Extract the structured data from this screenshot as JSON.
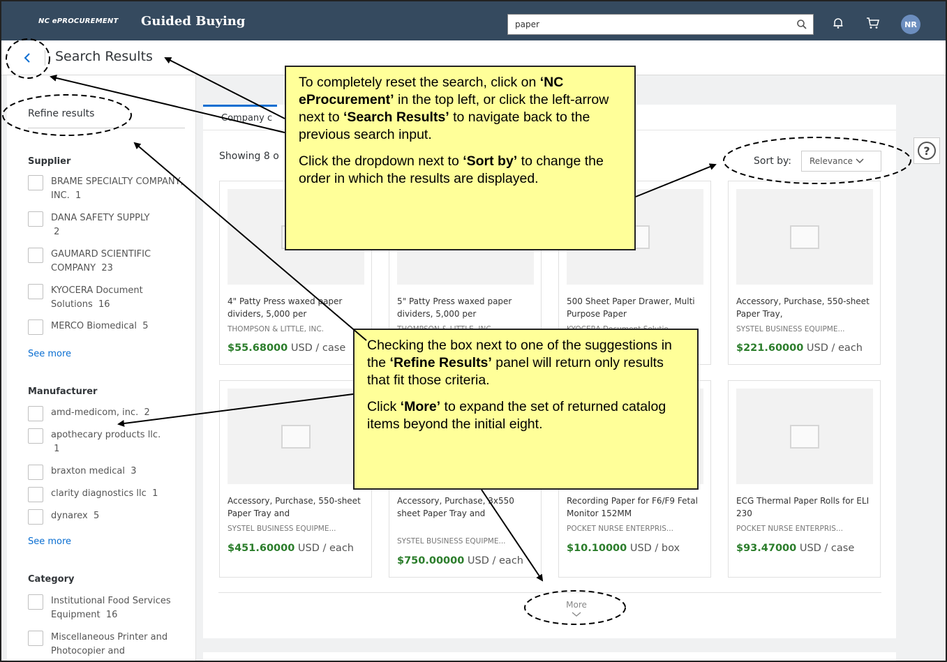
{
  "header": {
    "brand": "NC ePROCUREMENT",
    "title": "Guided Buying",
    "search_value": "paper",
    "avatar": "NR"
  },
  "subheader": {
    "title": "Search Results"
  },
  "sidebar": {
    "refine_title": "Refine results",
    "supplier": {
      "title": "Supplier",
      "items": [
        {
          "label": "BRAME SPECIALTY COMPANY, INC.",
          "count": "1"
        },
        {
          "label": "DANA SAFETY SUPPLY",
          "count": "2"
        },
        {
          "label": "GAUMARD SCIENTIFIC COMPANY",
          "count": "23"
        },
        {
          "label": "KYOCERA Document Solutions",
          "count": "16"
        },
        {
          "label": "MERCO Biomedical",
          "count": "5"
        }
      ],
      "see_more": "See more"
    },
    "manufacturer": {
      "title": "Manufacturer",
      "items": [
        {
          "label": "amd-medicom, inc.",
          "count": "2"
        },
        {
          "label": "apothecary products llc.",
          "count": "1"
        },
        {
          "label": "braxton medical",
          "count": "3"
        },
        {
          "label": "clarity diagnostics llc",
          "count": "1"
        },
        {
          "label": "dynarex",
          "count": "5"
        }
      ],
      "see_more": "See more"
    },
    "category": {
      "title": "Category",
      "items": [
        {
          "label": "Institutional Food Services Equipment",
          "count": "16"
        },
        {
          "label": "Miscellaneous Printer and Photocopier and",
          "count": ""
        }
      ]
    }
  },
  "main": {
    "tab": "Company c",
    "showing": "Showing 8 o",
    "sort_label": "Sort by:",
    "sort_value": "Relevance",
    "more_label": "More",
    "cards": [
      {
        "name": "4\" Patty Press waxed paper dividers, 5,000 per",
        "supplier": "THOMPSON & LITTLE, INC.",
        "price": "$55.68000",
        "unit": "USD / case"
      },
      {
        "name": "5\" Patty Press waxed paper dividers, 5,000 per",
        "supplier": "THOMPSON & LITTLE, INC.",
        "price": "",
        "unit": ""
      },
      {
        "name": "500 Sheet Paper Drawer, Multi Purpose Paper",
        "supplier": "KYOCERA Document Solutio",
        "price": "",
        "unit": ""
      },
      {
        "name": "Accessory, Purchase, 550-sheet Paper Tray,",
        "supplier": "SYSTEL BUSINESS EQUIPME...",
        "price": "$221.60000",
        "unit": "USD / each"
      },
      {
        "name": "Accessory, Purchase, 550-sheet Paper Tray and",
        "supplier": "SYSTEL BUSINESS EQUIPME...",
        "price": "$451.60000",
        "unit": "USD / each"
      },
      {
        "name": "Accessory, Purchase, 3x550 sheet Paper Tray and",
        "supplier": "SYSTEL BUSINESS EQUIPME...",
        "price": "$750.00000",
        "unit": "USD / each"
      },
      {
        "name": "Recording Paper for F6/F9 Fetal Monitor 152MM",
        "supplier": "POCKET NURSE ENTERPRIS...",
        "price": "$10.10000",
        "unit": "USD / box"
      },
      {
        "name": "ECG Thermal Paper Rolls for ELI 230",
        "supplier": "POCKET NURSE ENTERPRIS...",
        "price": "$93.47000",
        "unit": "USD / case"
      }
    ]
  },
  "callouts": {
    "top": {
      "p1_a": "To completely reset the search, click on ",
      "p1_b": "‘NC eProcurement’",
      "p1_c": " in the top left, or click the left-arrow next to ",
      "p1_d": "‘Search Results’",
      "p1_e": " to navigate back to the previous search input.",
      "p2_a": "Click the dropdown next to ",
      "p2_b": "‘Sort by’",
      "p2_c": " to change the order in which the results are displayed."
    },
    "bottom": {
      "p1_a": "Checking the box next to one of the suggestions in the ",
      "p1_b": "‘Refine Results’",
      "p1_c": " panel will return only results that fit those criteria.",
      "p2_a": "Click ",
      "p2_b": "‘More’",
      "p2_c": " to expand the set of returned catalog items beyond the initial eight."
    }
  },
  "colors": {
    "shellbar": "#354a5f",
    "link": "#0a6ed1",
    "price": "#2b7d2b",
    "callout": "#ffff99"
  }
}
